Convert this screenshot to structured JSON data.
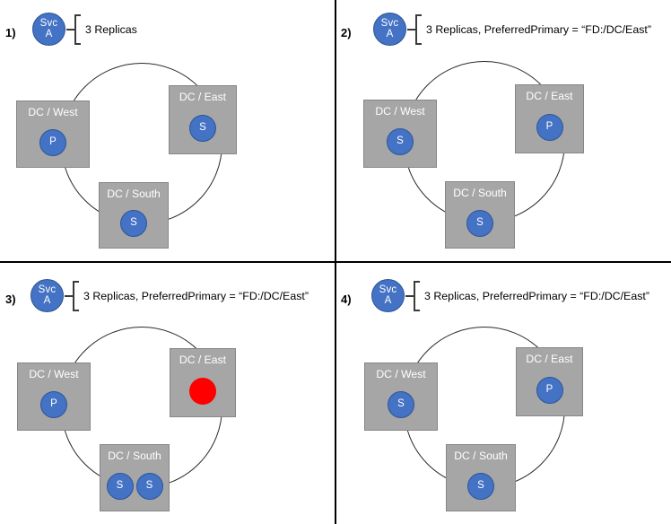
{
  "colors": {
    "replica_blue": "#4472C4",
    "replica_blue_border": "#2E5597",
    "down_red": "#FF0000",
    "dc_box_gray": "#A6A6A6",
    "dc_box_border": "#868686",
    "ring_stroke": "#2A2A2A",
    "divider": "#000000",
    "title_text": "#FFFFFF",
    "body_text": "#000000"
  },
  "panels": [
    {
      "index_label": "1)",
      "service": {
        "line1": "Svc",
        "line2": "A",
        "icon": "service-node-icon"
      },
      "constraint_label": "3 Replicas",
      "datacenters": [
        {
          "name": "DC / West",
          "replicas": [
            {
              "role": "P",
              "label": "P",
              "state": "primary"
            }
          ]
        },
        {
          "name": "DC / East",
          "replicas": [
            {
              "role": "S",
              "label": "S",
              "state": "secondary"
            }
          ]
        },
        {
          "name": "DC / South",
          "replicas": [
            {
              "role": "S",
              "label": "S",
              "state": "secondary"
            }
          ]
        }
      ]
    },
    {
      "index_label": "2)",
      "service": {
        "line1": "Svc",
        "line2": "A",
        "icon": "service-node-icon"
      },
      "constraint_label": "3 Replicas, PreferredPrimary = “FD:/DC/East”",
      "datacenters": [
        {
          "name": "DC / West",
          "replicas": [
            {
              "role": "S",
              "label": "S",
              "state": "secondary"
            }
          ]
        },
        {
          "name": "DC / East",
          "replicas": [
            {
              "role": "P",
              "label": "P",
              "state": "primary"
            }
          ]
        },
        {
          "name": "DC / South",
          "replicas": [
            {
              "role": "S",
              "label": "S",
              "state": "secondary"
            }
          ]
        }
      ]
    },
    {
      "index_label": "3)",
      "service": {
        "line1": "Svc",
        "line2": "A",
        "icon": "service-node-icon"
      },
      "constraint_label": "3 Replicas, PreferredPrimary = “FD:/DC/East”",
      "datacenters": [
        {
          "name": "DC / West",
          "replicas": [
            {
              "role": "P",
              "label": "P",
              "state": "primary"
            }
          ]
        },
        {
          "name": "DC / East",
          "replicas": [
            {
              "role": "down",
              "label": "",
              "state": "down"
            }
          ]
        },
        {
          "name": "DC / South",
          "replicas": [
            {
              "role": "S",
              "label": "S",
              "state": "secondary"
            },
            {
              "role": "S",
              "label": "S",
              "state": "secondary"
            }
          ]
        }
      ]
    },
    {
      "index_label": "4)",
      "service": {
        "line1": "Svc",
        "line2": "A",
        "icon": "service-node-icon"
      },
      "constraint_label": "3 Replicas, PreferredPrimary = “FD:/DC/East”",
      "datacenters": [
        {
          "name": "DC / West",
          "replicas": [
            {
              "role": "S",
              "label": "S",
              "state": "secondary"
            }
          ]
        },
        {
          "name": "DC / East",
          "replicas": [
            {
              "role": "P",
              "label": "P",
              "state": "primary"
            }
          ]
        },
        {
          "name": "DC / South",
          "replicas": [
            {
              "role": "S",
              "label": "S",
              "state": "secondary"
            }
          ]
        }
      ]
    }
  ]
}
